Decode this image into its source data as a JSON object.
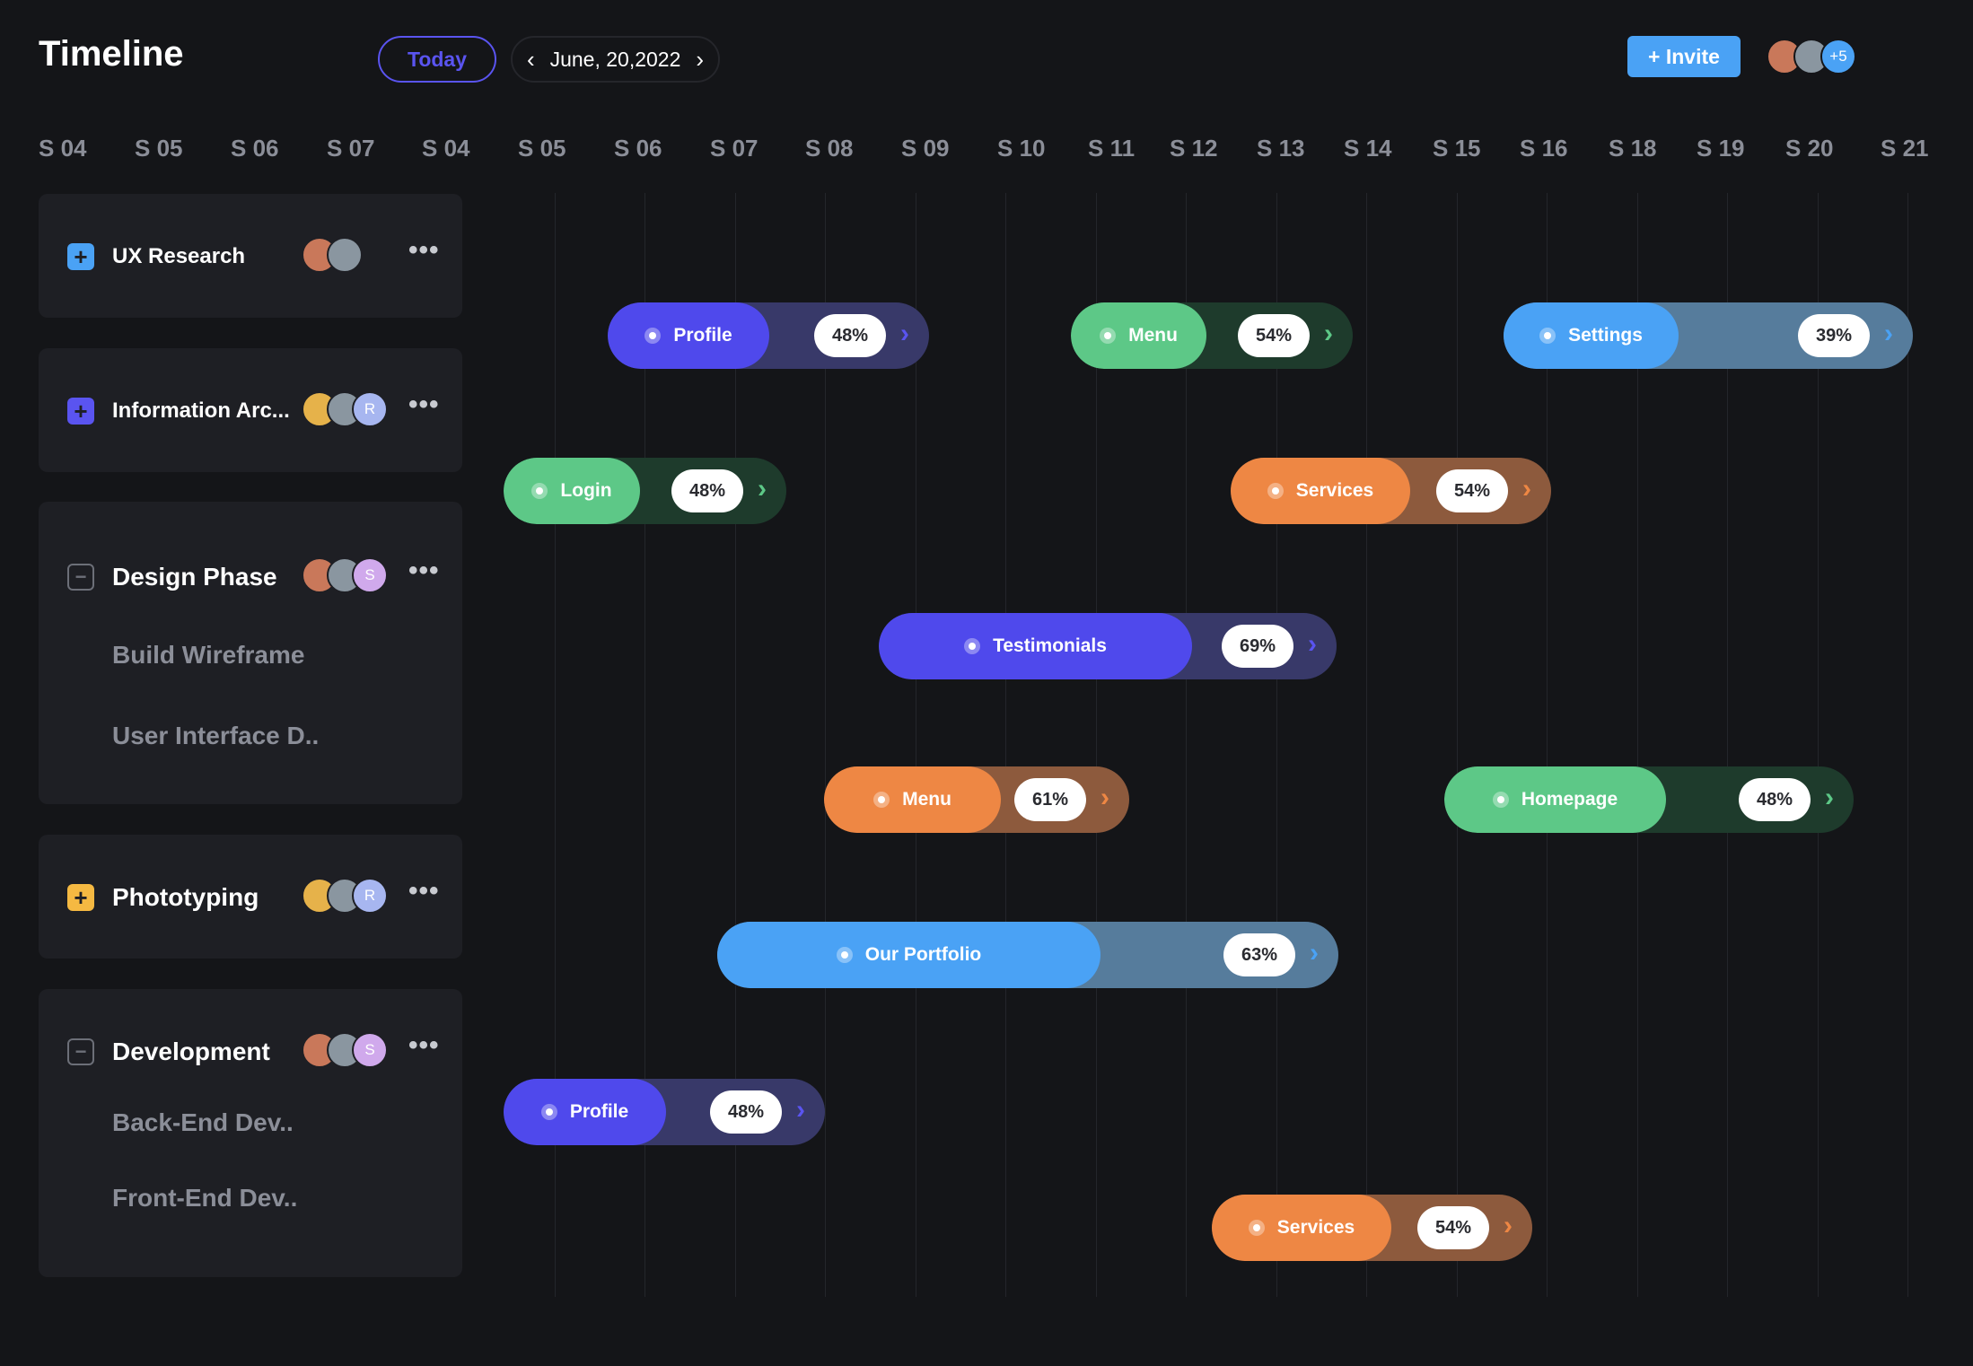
{
  "header": {
    "title": "Timeline",
    "today_label": "Today",
    "date": "June, 20,2022",
    "prev_icon": "chevron-left-icon",
    "next_icon": "chevron-right-icon",
    "invite_label": "+ Invite",
    "avatars": [
      {
        "name": "avatar-1",
        "color": "#c9785a"
      },
      {
        "name": "avatar-2",
        "color": "#8a96a0"
      }
    ],
    "more_count": "+5"
  },
  "weeks": [
    "S 04",
    "S 05",
    "S 06",
    "S 07",
    "S 04",
    "S 05",
    "S 06",
    "S 07",
    "S 08",
    "S 09",
    "S 10",
    "S 11",
    "S 12",
    "S 13",
    "S 14",
    "S 15",
    "S 16",
    "S 18",
    "S 19",
    "S 20",
    "S 21"
  ],
  "groups": [
    {
      "name": "UX Research",
      "icon": "plus-icon",
      "icon_color": "#4aa2f5",
      "avatars": [
        "",
        ""
      ],
      "subitems": []
    },
    {
      "name": "Information Arc...",
      "icon": "plus-icon",
      "icon_color": "#5a54f0",
      "avatars": [
        "",
        "",
        "R"
      ],
      "subitems": []
    },
    {
      "name": "Design Phase",
      "icon": "minus-icon",
      "icon_color": "#6c6f78",
      "avatars": [
        "",
        "",
        "S"
      ],
      "subitems": [
        "Build Wireframe",
        "User Interface D.."
      ]
    },
    {
      "name": "Phototyping",
      "icon": "plus-icon",
      "icon_color": "#f5b942",
      "avatars": [
        "",
        "",
        "R"
      ],
      "subitems": []
    },
    {
      "name": "Development",
      "icon": "minus-icon",
      "icon_color": "#6c6f78",
      "avatars": [
        "",
        "",
        "S"
      ],
      "subitems": [
        "Back-End Dev..",
        "Front-End Dev.."
      ]
    }
  ],
  "colors": {
    "blue": "#4f49ec",
    "green": "#5dc887",
    "lightblue": "#4aa2f5",
    "orange": "#ee8744",
    "blue_track": "#383969",
    "green_track": "#1e3b2c",
    "lightblue_track": "#567c9c",
    "orange_track": "#8d5a3d"
  },
  "tasks": [
    {
      "label": "Profile",
      "progress": "48%",
      "color": "blue"
    },
    {
      "label": "Menu",
      "progress": "54%",
      "color": "green"
    },
    {
      "label": "Settings",
      "progress": "39%",
      "color": "lightblue"
    },
    {
      "label": "Login",
      "progress": "48%",
      "color": "green"
    },
    {
      "label": "Services",
      "progress": "54%",
      "color": "orange"
    },
    {
      "label": "Testimonials",
      "progress": "69%",
      "color": "blue"
    },
    {
      "label": "Menu",
      "progress": "61%",
      "color": "orange"
    },
    {
      "label": "Homepage",
      "progress": "48%",
      "color": "green"
    },
    {
      "label": "Our Portfolio",
      "progress": "63%",
      "color": "lightblue"
    },
    {
      "label": "Profile",
      "progress": "48%",
      "color": "blue"
    },
    {
      "label": "Services",
      "progress": "54%",
      "color": "orange"
    }
  ]
}
